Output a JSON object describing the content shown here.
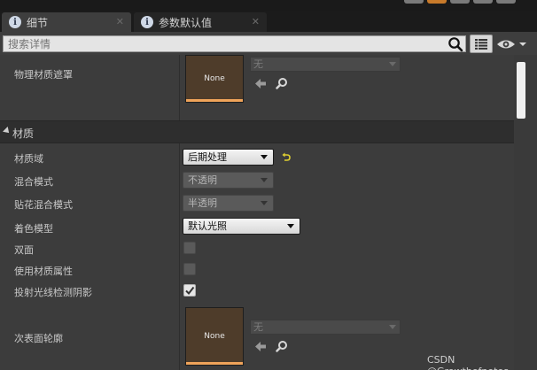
{
  "tabs": [
    {
      "label": "细节",
      "close": "✕"
    },
    {
      "label": "参数默认值",
      "close": "✕"
    }
  ],
  "search": {
    "placeholder": "搜索详情"
  },
  "physical_mask": {
    "label": "物理材质遮罩",
    "thumb": "None",
    "value": "无"
  },
  "section": {
    "title": "材质"
  },
  "properties": [
    {
      "label": "材质域",
      "value": "后期处理",
      "enabled": true
    },
    {
      "label": "混合模式",
      "value": "不透明",
      "enabled": false
    },
    {
      "label": "贴花混合模式",
      "value": "半透明",
      "enabled": false
    },
    {
      "label": "着色模型",
      "value": "默认光照",
      "enabled": true
    }
  ],
  "checkboxes": [
    {
      "label": "双面",
      "checked": false
    },
    {
      "label": "使用材质属性",
      "checked": false
    },
    {
      "label": "投射光线检测阴影",
      "checked": true
    }
  ],
  "subsurface": {
    "label": "次表面轮廓",
    "thumb": "None",
    "value": "无"
  },
  "watermark": "CSDN @Growthofnotes",
  "icons": {
    "tab": "info-icon",
    "search": "search-icon",
    "grid": "grid-view-icon",
    "eye": "eye-icon",
    "arrow": "use-selected-arrow-icon",
    "browse": "browse-magnifier-icon",
    "reset": "reset-to-default-icon"
  }
}
